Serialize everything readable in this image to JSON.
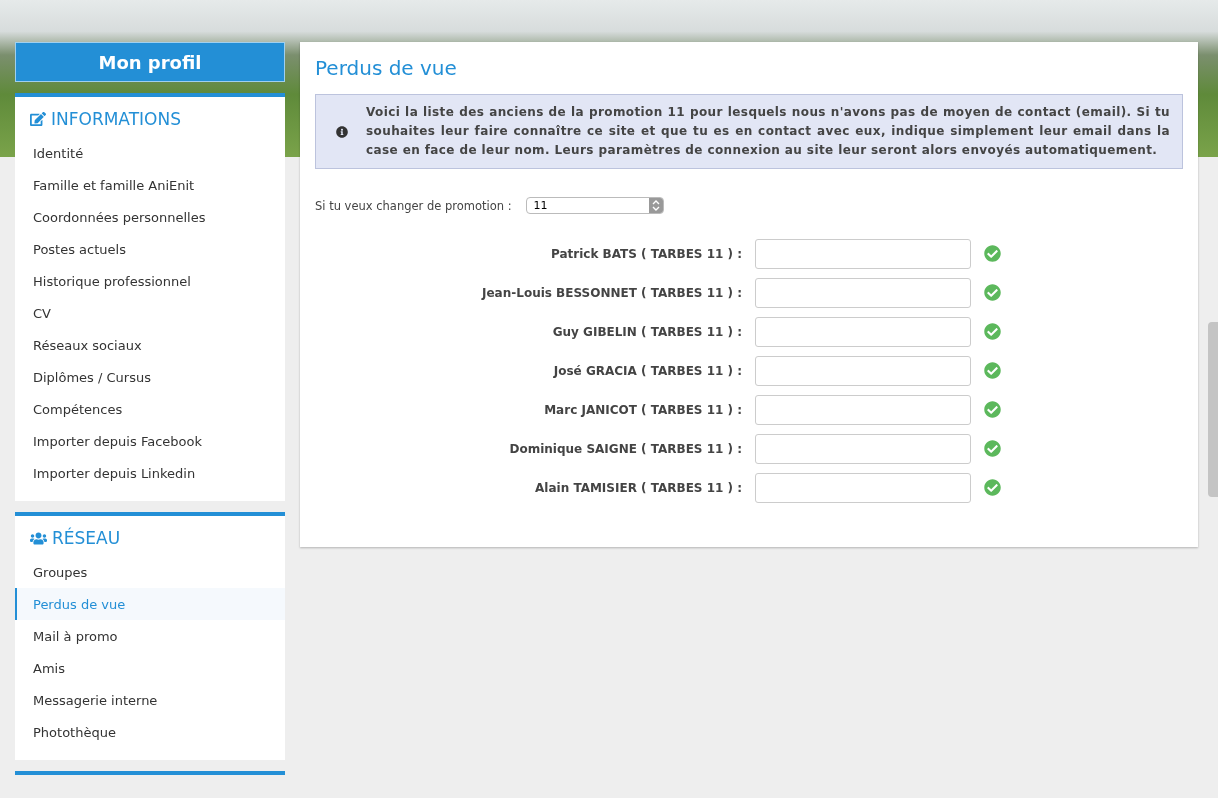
{
  "sidebar": {
    "header": "Mon profil",
    "sections": [
      {
        "kind": "edit",
        "title": "INFORMATIONS",
        "items": [
          {
            "label": "Identité",
            "selected": false
          },
          {
            "label": "Famille et famille AniEnit",
            "selected": false
          },
          {
            "label": "Coordonnées personnelles",
            "selected": false
          },
          {
            "label": "Postes actuels",
            "selected": false
          },
          {
            "label": "Historique professionnel",
            "selected": false
          },
          {
            "label": "CV",
            "selected": false
          },
          {
            "label": "Réseaux sociaux",
            "selected": false
          },
          {
            "label": "Diplômes / Cursus",
            "selected": false
          },
          {
            "label": "Compétences",
            "selected": false
          },
          {
            "label": "Importer depuis Facebook",
            "selected": false
          },
          {
            "label": "Importer depuis Linkedin",
            "selected": false
          }
        ]
      },
      {
        "kind": "users",
        "title": "RÉSEAU",
        "items": [
          {
            "label": "Groupes",
            "selected": false
          },
          {
            "label": "Perdus de vue",
            "selected": true
          },
          {
            "label": "Mail à promo",
            "selected": false
          },
          {
            "label": "Amis",
            "selected": false
          },
          {
            "label": "Messagerie interne",
            "selected": false
          },
          {
            "label": "Photothèque",
            "selected": false
          }
        ]
      }
    ]
  },
  "main": {
    "title": "Perdus de vue",
    "notice": "Voici la liste des anciens de la promotion 11 pour lesquels nous n'avons pas de moyen de contact (email). Si tu souhaites leur faire connaître ce site et que tu es en contact avec eux, indique simplement leur email dans la case en face de leur nom. Leurs paramètres de connexion au site leur seront alors envoyés automatiquement.",
    "promotion_label": "Si tu veux changer de promotion :",
    "promotion_value": "11",
    "people": [
      {
        "name": "Patrick BATS ( TARBES 11 ) :"
      },
      {
        "name": "Jean-Louis BESSONNET ( TARBES 11 ) :"
      },
      {
        "name": "Guy GIBELIN ( TARBES 11 ) :"
      },
      {
        "name": "José GRACIA ( TARBES 11 ) :"
      },
      {
        "name": "Marc JANICOT ( TARBES 11 ) :"
      },
      {
        "name": "Dominique SAIGNE ( TARBES 11 ) :"
      },
      {
        "name": "Alain TAMISIER ( TARBES 11 ) :"
      }
    ]
  }
}
